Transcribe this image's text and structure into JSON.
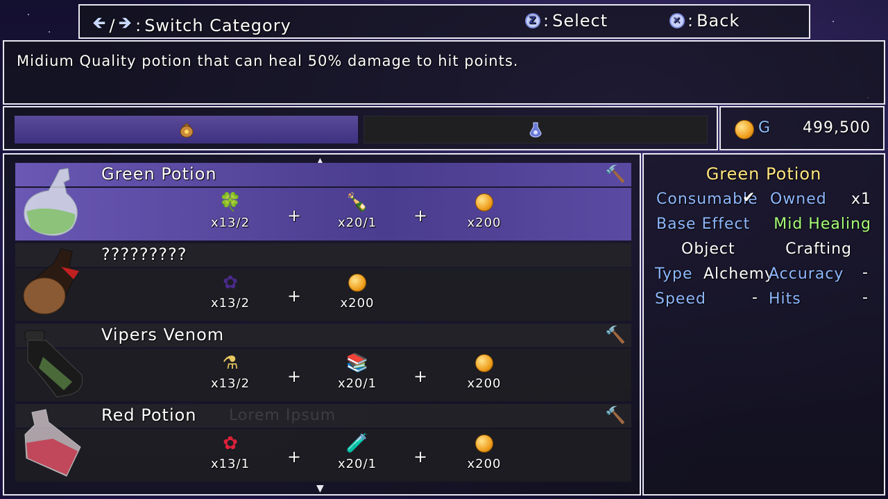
{
  "help": {
    "switch_label": "Switch Category",
    "select_key": "Z",
    "select_label": "Select",
    "back_key": "✕",
    "back_label": "Back"
  },
  "description": "Midium Quality potion that can heal 50% damage to hit points.",
  "tabs": [
    {
      "icon": "money-bag-icon",
      "selected": true
    },
    {
      "icon": "crystal-flask-icon",
      "selected": false
    }
  ],
  "gold": {
    "unit": "G",
    "amount": "499,500"
  },
  "recipes": [
    {
      "name": "Green Potion",
      "craftable": true,
      "selected": true,
      "materials": [
        {
          "icon": "clover-icon",
          "qty": "x13/2"
        },
        {
          "icon": "bottle-icon",
          "qty": "x20/1"
        },
        {
          "icon": "coin-icon",
          "qty": "x200"
        }
      ]
    },
    {
      "name": "?????????",
      "craftable": false,
      "selected": false,
      "materials": [
        {
          "icon": "dark-flower-icon",
          "qty": "x13/2"
        },
        {
          "icon": "coin-icon",
          "qty": "x200"
        }
      ]
    },
    {
      "name": "Vipers Venom",
      "craftable": true,
      "selected": false,
      "materials": [
        {
          "icon": "vial-icon",
          "qty": "x13/2"
        },
        {
          "icon": "book-icon",
          "qty": "x20/1"
        },
        {
          "icon": "coin-icon",
          "qty": "x200"
        }
      ]
    },
    {
      "name": "Red Potion",
      "craftable": true,
      "selected": false,
      "materials": [
        {
          "icon": "red-flower-icon",
          "qty": "x13/1"
        },
        {
          "icon": "green-vial-icon",
          "qty": "x20/1"
        },
        {
          "icon": "coin-icon",
          "qty": "x200"
        }
      ]
    }
  ],
  "ghost_text": "Lorem Ipsum",
  "detail": {
    "title": "Green Potion",
    "consumable_label": "Consumable",
    "owned_label": "Owned",
    "owned_value": "x1",
    "base_effect_label": "Base Effect",
    "base_effect_value": "Mid Healing",
    "object_label": "Object",
    "object_value": "Crafting",
    "type_label": "Type",
    "type_value": "Alchemy",
    "accuracy_label": "Accuracy",
    "accuracy_value": "-",
    "speed_label": "Speed",
    "speed_value": "-",
    "hits_label": "Hits",
    "hits_value": "-"
  },
  "colors": {
    "accent": "#5a4a9a",
    "label": "#8fb8ff",
    "title": "#ffe680",
    "effect": "#a8ff7a"
  }
}
